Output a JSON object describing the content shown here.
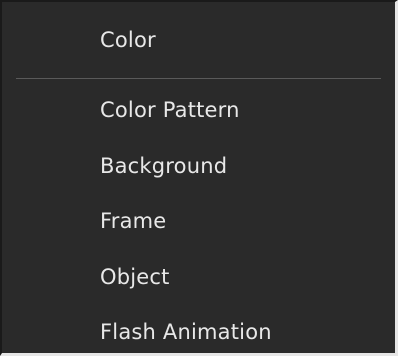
{
  "menu": {
    "header_label": "Color",
    "items": [
      {
        "label": "Color Pattern"
      },
      {
        "label": "Background"
      },
      {
        "label": "Frame"
      },
      {
        "label": "Object"
      },
      {
        "label": "Flash Animation"
      }
    ]
  },
  "colors": {
    "menu_background": "#2a2a2a",
    "text": "#e8e8e8",
    "separator": "#5a5a5a"
  }
}
